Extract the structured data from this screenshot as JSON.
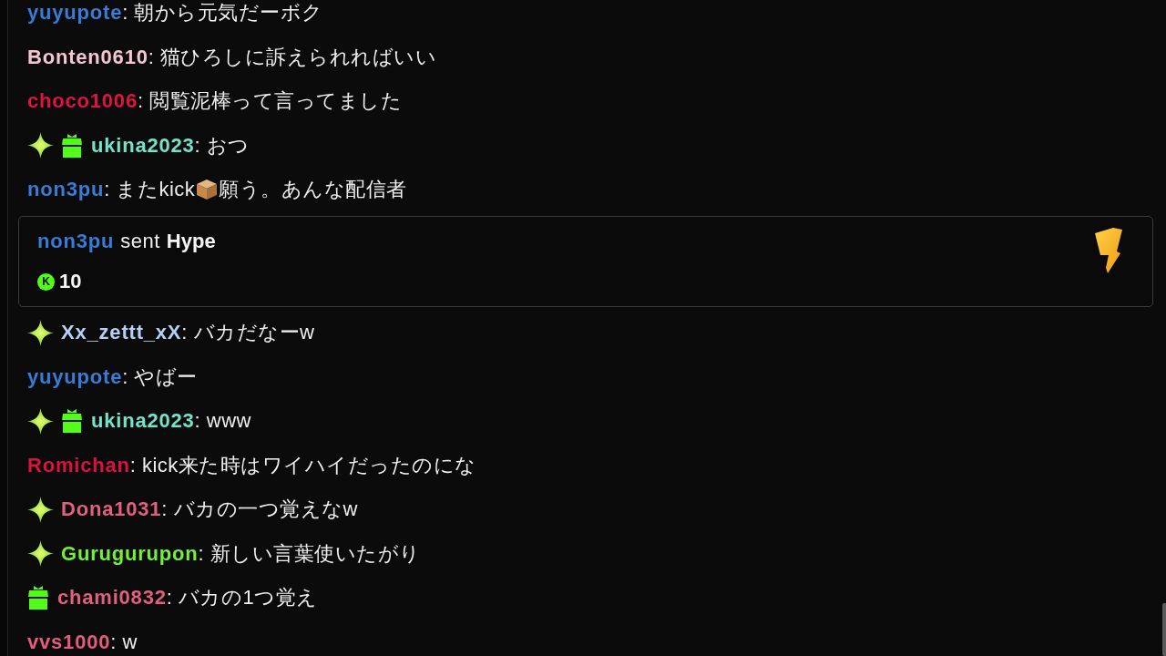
{
  "chat": [
    {
      "kind": "message",
      "user": "yuyupote",
      "color": "#3a7bd5",
      "text": ": 朝から元気だーボク"
    },
    {
      "kind": "message",
      "user": "Bonten0610",
      "color": "#f4c6d2",
      "text": ": 猫ひろしに訴えられればいい"
    },
    {
      "kind": "message",
      "user": "choco1006",
      "color": "#dc1440",
      "text": ": 閲覧泥棒って言ってました"
    },
    {
      "kind": "message",
      "badges": [
        {
          "kind": "sparkle"
        },
        {
          "kind": "gift"
        }
      ],
      "user": "ukina2023",
      "color": "#74e3c8",
      "text": ": おつ"
    },
    {
      "kind": "message",
      "user": "non3pu",
      "color": "#3a7bd5",
      "parts": [
        {
          "kind": "text",
          "text": ": またkick"
        },
        {
          "kind": "emote"
        },
        {
          "kind": "text",
          "text": "願う。あんな配信者"
        }
      ]
    },
    {
      "kind": "hype",
      "user": "non3pu",
      "color": "#3a7bd5",
      "action": "sent",
      "gift": "Hype",
      "coin": "K",
      "amount": "10"
    },
    {
      "kind": "message",
      "badges": [
        {
          "kind": "sparkle"
        }
      ],
      "user": "Xx_zettt_xX",
      "color": "#b5d0f5",
      "text": ": バカだなーw"
    },
    {
      "kind": "message",
      "user": "yuyupote",
      "color": "#3a7bd5",
      "text": ": やばー"
    },
    {
      "kind": "message",
      "badges": [
        {
          "kind": "sparkle"
        },
        {
          "kind": "gift"
        }
      ],
      "user": "ukina2023",
      "color": "#74e3c8",
      "text": ": www"
    },
    {
      "kind": "message",
      "user": "Romichan",
      "color": "#d9123f",
      "text": ": kick来た時はワイハイだったのにな"
    },
    {
      "kind": "message",
      "badges": [
        {
          "kind": "sparkle"
        }
      ],
      "user": "Dona1031",
      "color": "#e0607e",
      "text": ": バカの一つ覚えなw"
    },
    {
      "kind": "message",
      "badges": [
        {
          "kind": "sparkle"
        }
      ],
      "user": "Gurugurupon",
      "color": "#72f03c",
      "text": ": 新しい言葉使いたがり"
    },
    {
      "kind": "message",
      "badges": [
        {
          "kind": "gift"
        }
      ],
      "user": "chami0832",
      "color": "#e0607e",
      "text": ": バカの1つ覚え"
    },
    {
      "kind": "message",
      "user": "vvs1000",
      "color": "#e25c7c",
      "text": ": w"
    }
  ]
}
